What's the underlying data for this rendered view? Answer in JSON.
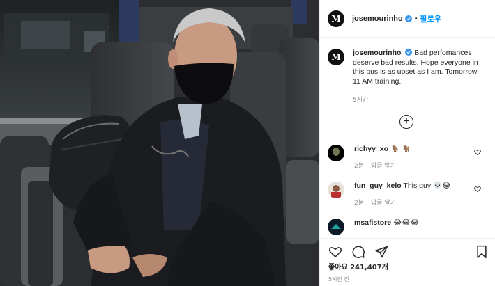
{
  "post": {
    "username": "josemourinho",
    "follow_label": "팔로우",
    "separator": "•",
    "caption": "Bad perfomances deserve bad results. Hope everyone in this bus is as upset as I am. Tomorrow 11 AM training.",
    "time_ago": "5시간",
    "more_comments_icon": "plus-circle-icon",
    "likes": "좋아요 241,407개",
    "posted_ago": "5시간 전"
  },
  "comments": [
    {
      "username": "richyy_xo",
      "text": "🐐 🐐",
      "age": "2분",
      "reply": "답글 달기"
    },
    {
      "username": "fun_guy_kelo",
      "text": "This guy 💀😂",
      "age": "2분",
      "reply": "답글 달기"
    },
    {
      "username": "msafistore",
      "text": "😂😂😂"
    }
  ],
  "colors": {
    "accent": "#0095f6",
    "muted": "#8e8e8e",
    "text": "#262626",
    "verified": "#3897f0"
  }
}
